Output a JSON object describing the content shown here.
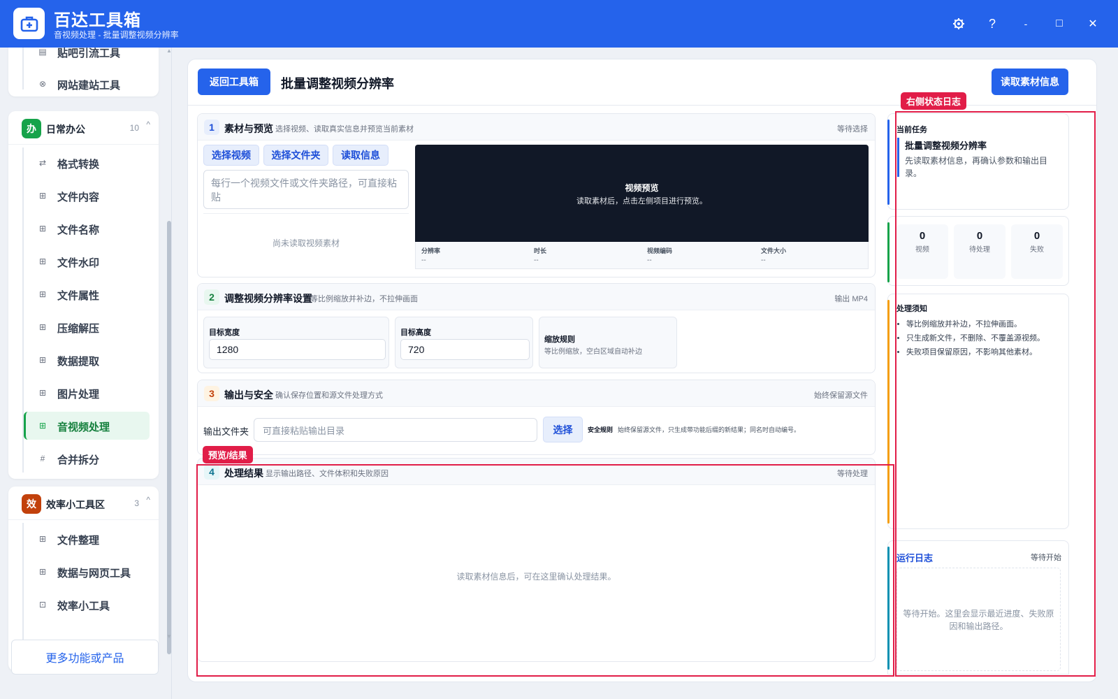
{
  "app": {
    "title": "百达工具箱",
    "subtitle": "音视频处理 - 批量调整视频分辨率",
    "brand_color": "#2563eb"
  },
  "window_controls": {
    "settings_icon": "gear-icon",
    "help": "?",
    "minimize": "-",
    "maximize": "□",
    "close": "✕"
  },
  "sidebar": {
    "top_items": [
      {
        "label": "贴吧引流工具",
        "icon": "document-icon"
      },
      {
        "label": "网站建站工具",
        "icon": "web-icon"
      }
    ],
    "groups": [
      {
        "badge": "办",
        "badge_color": "#16a34a",
        "name": "日常办公",
        "count": "10",
        "items": [
          {
            "label": "格式转换",
            "icon": "swap-icon"
          },
          {
            "label": "文件内容",
            "icon": "grid-icon"
          },
          {
            "label": "文件名称",
            "icon": "grid-icon"
          },
          {
            "label": "文件水印",
            "icon": "grid-icon"
          },
          {
            "label": "文件属性",
            "icon": "grid-icon"
          },
          {
            "label": "压缩解压",
            "icon": "grid-icon"
          },
          {
            "label": "数据提取",
            "icon": "grid-icon"
          },
          {
            "label": "图片处理",
            "icon": "grid-icon"
          },
          {
            "label": "音视频处理",
            "icon": "grid-icon",
            "active": true
          },
          {
            "label": "合并拆分",
            "icon": "hash-icon"
          }
        ]
      },
      {
        "badge": "效",
        "badge_color": "#c2410c",
        "name": "效率小工具区",
        "count": "3",
        "items": [
          {
            "label": "文件整理",
            "icon": "grid-icon"
          },
          {
            "label": "数据与网页工具",
            "icon": "grid-icon"
          },
          {
            "label": "效率小工具",
            "icon": "toolbox-icon"
          }
        ]
      }
    ],
    "more_label": "更多功能或产品"
  },
  "main": {
    "back_label": "返回工具箱",
    "page_title": "批量调整视频分辨率",
    "read_info_label": "读取素材信息",
    "sections": {
      "s1": {
        "num": "1",
        "title": "素材与预览",
        "desc": "选择视频、读取真实信息并预览当前素材",
        "status": "等待选择",
        "buttons": [
          "选择视频",
          "选择文件夹",
          "读取信息"
        ],
        "paths_placeholder": "每行一个视频文件或文件夹路径，可直接粘贴",
        "empty_text": "尚未读取视频素材",
        "preview_title": "视频预览",
        "preview_sub": "读取素材后，点击左侧项目进行预览。",
        "meta": [
          {
            "label": "分辨率",
            "value": "--"
          },
          {
            "label": "时长",
            "value": "--"
          },
          {
            "label": "视频编码",
            "value": "--"
          },
          {
            "label": "文件大小",
            "value": "--"
          }
        ]
      },
      "s2": {
        "num": "2",
        "title": "调整视频分辨率设置",
        "desc": "等比例缩放并补边，不拉伸画面",
        "status": "输出 MP4",
        "width_label": "目标宽度",
        "width_value": "1280",
        "height_label": "目标高度",
        "height_value": "720",
        "rule_label": "缩放规则",
        "rule_desc": "等比例缩放，空白区域自动补边"
      },
      "s3": {
        "num": "3",
        "title": "输出与安全",
        "desc": "确认保存位置和源文件处理方式",
        "status": "始终保留源文件",
        "folder_label": "输出文件夹",
        "folder_placeholder": "可直接粘贴输出目录",
        "choose_label": "选择",
        "safety_label": "安全规则",
        "safety_desc": "始终保留源文件，只生成带功能后缀的新结果；同名时自动编号。"
      },
      "s4": {
        "num": "4",
        "title": "处理结果",
        "desc": "显示输出路径、文件体积和失败原因",
        "status": "等待处理",
        "empty_text": "读取素材信息后，可在这里确认处理结果。"
      }
    },
    "annotations": {
      "preview_result": "预览/结果",
      "right_log": "右侧状态日志"
    }
  },
  "right_panel": {
    "task_label": "当前任务",
    "task_title": "批量调整视频分辨率",
    "task_desc": "先读取素材信息，再确认参数和输出目录。",
    "stats": [
      {
        "value": "0",
        "label": "视频"
      },
      {
        "value": "0",
        "label": "待处理"
      },
      {
        "value": "0",
        "label": "失败"
      }
    ],
    "notes_title": "处理须知",
    "notes": [
      "等比例缩放并补边，不拉伸画面。",
      "只生成新文件，不删除、不覆盖源视频。",
      "失败项目保留原因，不影响其他素材。"
    ],
    "log_title": "运行日志",
    "log_status": "等待开始",
    "log_empty": "等待开始。这里会显示最近进度、失败原因和输出路径。"
  }
}
